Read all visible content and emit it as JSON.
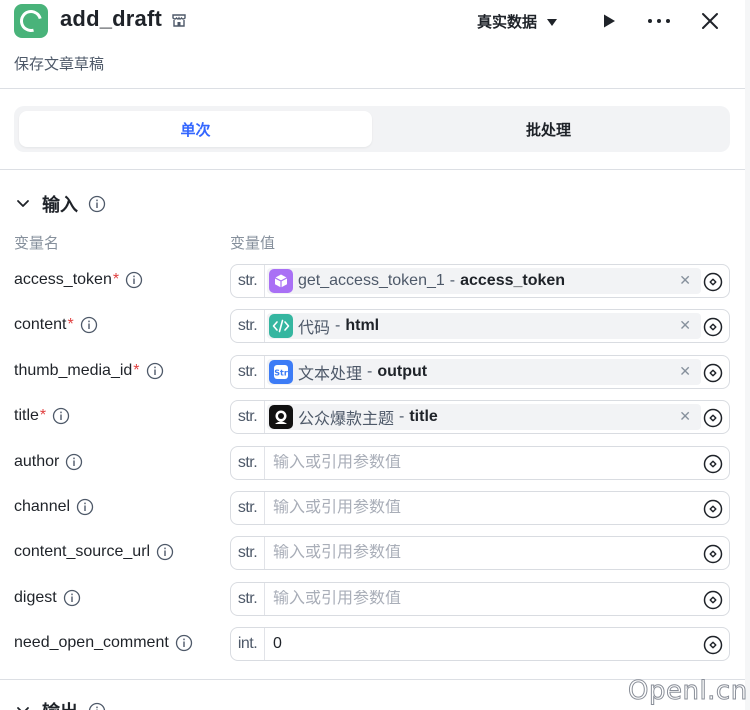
{
  "header": {
    "title": "add_draft",
    "subtitle": "保存文章草稿",
    "mode_label": "真实数据"
  },
  "tabs": [
    {
      "label": "单次",
      "active": true
    },
    {
      "label": "批处理",
      "active": false
    }
  ],
  "input_section": {
    "title": "输入",
    "col_name": "变量名",
    "col_value": "变量值"
  },
  "fields": [
    {
      "name": "access_token",
      "required": "*",
      "type": "str.",
      "ref": {
        "node": "get_access_token_1",
        "sep": "-",
        "var": "access_token",
        "icon": "cube-icon",
        "color": "#a970f5"
      }
    },
    {
      "name": "content",
      "required": "*",
      "type": "str.",
      "ref": {
        "node": "代码",
        "sep": "-",
        "var": "html",
        "icon": "code-icon",
        "color": "#35b6a0"
      }
    },
    {
      "name": "thumb_media_id",
      "required": "*",
      "type": "str.",
      "ref": {
        "node": "文本处理",
        "sep": "-",
        "var": "output",
        "icon": "str-icon",
        "color": "#3d7cf6"
      }
    },
    {
      "name": "title",
      "required": "*",
      "type": "str.",
      "ref": {
        "node": "公众爆款主题",
        "sep": "-",
        "var": "title",
        "icon": "avatar-icon",
        "color": "#111111"
      }
    },
    {
      "name": "author",
      "required": "",
      "type": "str.",
      "placeholder": "输入或引用参数值",
      "value": ""
    },
    {
      "name": "channel",
      "required": "",
      "type": "str.",
      "placeholder": "输入或引用参数值",
      "value": ""
    },
    {
      "name": "content_source_url",
      "required": "",
      "type": "str.",
      "placeholder": "输入或引用参数值",
      "value": ""
    },
    {
      "name": "digest",
      "required": "",
      "type": "str.",
      "placeholder": "输入或引用参数值",
      "value": ""
    },
    {
      "name": "need_open_comment",
      "required": "",
      "type": "int.",
      "placeholder": "",
      "value": "0"
    }
  ],
  "output_section": {
    "title": "输出"
  },
  "watermark": "Openl.cn"
}
